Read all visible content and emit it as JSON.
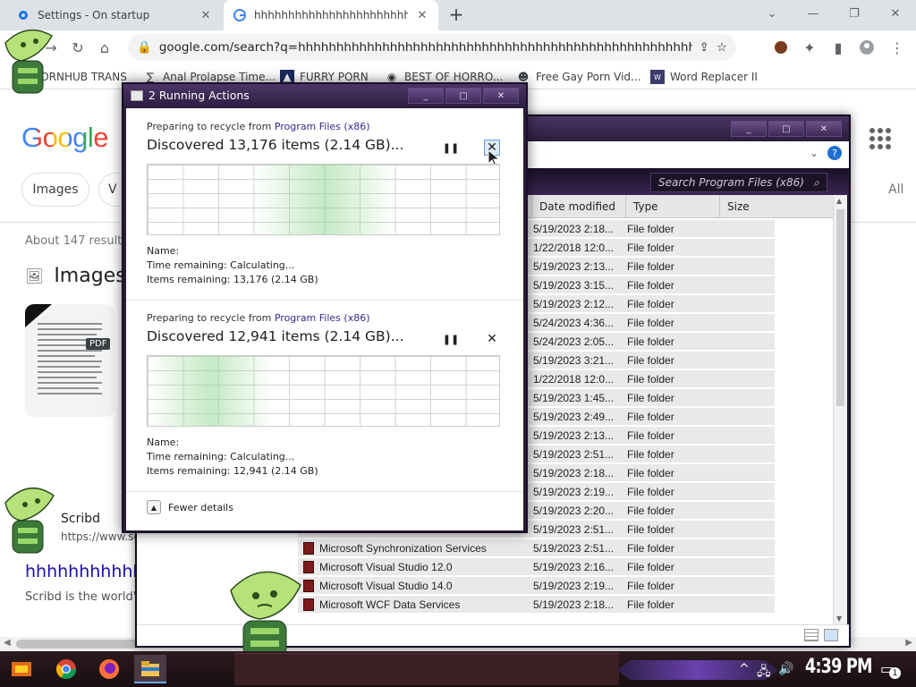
{
  "browser": {
    "tabs": [
      {
        "title": "Settings - On startup"
      },
      {
        "title": "hhhhhhhhhhhhhhhhhhhhhhhhhh"
      }
    ],
    "new_tab": "+",
    "omnibox_url": "google.com/search?q=hhhhhhhhhhhhhhhhhhhhhhhhhhhhhhhhhhhhhhhhhhhhhhhhhhhhhhhhhhhhhhhhhhhhh...",
    "bookmarks": [
      {
        "label": "PORNHUB TRANS"
      },
      {
        "label": "Anal Prolapse Time..."
      },
      {
        "label": "FURRY PORN"
      },
      {
        "label": "BEST OF HORRO..."
      },
      {
        "label": "Free Gay Porn Vid..."
      },
      {
        "label": "Word Replacer II"
      }
    ]
  },
  "google": {
    "logo": "Google",
    "chips": [
      "Images",
      "V"
    ],
    "all_label": "All",
    "result_count": "About 147 result",
    "images_heading": "Images",
    "pdf_badge": "PDF",
    "result_site_name": "Scribd",
    "result_site_url": "https://www.scri",
    "result_title": "hhhhhhhhhhh",
    "result_snippet": "Scribd is the world's"
  },
  "explorer": {
    "search_placeholder": "Search Program Files (x86)",
    "columns": [
      "Date modified",
      "Type",
      "Size"
    ],
    "rows": [
      {
        "name": "",
        "date": "5/19/2023 2:18...",
        "type": "File folder"
      },
      {
        "name": "",
        "date": "1/22/2018 12:0...",
        "type": "File folder"
      },
      {
        "name": "",
        "date": "5/19/2023 2:13...",
        "type": "File folder"
      },
      {
        "name": "",
        "date": "5/19/2023 3:15...",
        "type": "File folder"
      },
      {
        "name": "",
        "date": "5/19/2023 2:12...",
        "type": "File folder"
      },
      {
        "name": "",
        "date": "5/24/2023 4:36...",
        "type": "File folder"
      },
      {
        "name": "",
        "date": "5/24/2023 2:05...",
        "type": "File folder"
      },
      {
        "name": "",
        "date": "5/19/2023 3:21...",
        "type": "File folder"
      },
      {
        "name": "",
        "date": "1/22/2018 12:0...",
        "type": "File folder"
      },
      {
        "name": "",
        "date": "5/19/2023 1:45...",
        "type": "File folder"
      },
      {
        "name": "",
        "date": "5/19/2023 2:49...",
        "type": "File folder"
      },
      {
        "name": "",
        "date": "5/19/2023 2:13...",
        "type": "File folder"
      },
      {
        "name": "",
        "date": "5/19/2023 2:51...",
        "type": "File folder"
      },
      {
        "name": "",
        "date": "5/19/2023 2:18...",
        "type": "File folder"
      },
      {
        "name": "",
        "date": "5/19/2023 2:19...",
        "type": "File folder"
      },
      {
        "name": "",
        "date": "5/19/2023 2:20...",
        "type": "File folder"
      },
      {
        "name": "",
        "date": "5/19/2023 2:51...",
        "type": "File folder"
      },
      {
        "name": "Microsoft Synchronization Services",
        "date": "5/19/2023 2:51...",
        "type": "File folder"
      },
      {
        "name": "Microsoft Visual Studio 12.0",
        "date": "5/19/2023 2:16...",
        "type": "File folder"
      },
      {
        "name": "Microsoft Visual Studio 14.0",
        "date": "5/19/2023 2:19...",
        "type": "File folder"
      },
      {
        "name": "Microsoft WCF Data Services",
        "date": "5/19/2023 2:18...",
        "type": "File folder"
      }
    ]
  },
  "dialog": {
    "title": "2 Running Actions",
    "operations": [
      {
        "prep_prefix": "Preparing to recycle from ",
        "prep_location": "Program Files (x86)",
        "discovered": "Discovered 13,176 items (2.14 GB)...",
        "name_label": "Name:",
        "time_remaining": "Time remaining: Calculating...",
        "items_remaining": "Items remaining: 13,176 (2.14 GB)"
      },
      {
        "prep_prefix": "Preparing to recycle from ",
        "prep_location": "Program Files (x86)",
        "discovered": "Discovered 12,941 items (2.14 GB)...",
        "name_label": "Name:",
        "time_remaining": "Time remaining: Calculating...",
        "items_remaining": "Items remaining: 12,941 (2.14 GB)"
      }
    ],
    "fewer_details": "Fewer details"
  },
  "taskbar": {
    "clock": "4:39 PM",
    "notification_count": "1"
  }
}
